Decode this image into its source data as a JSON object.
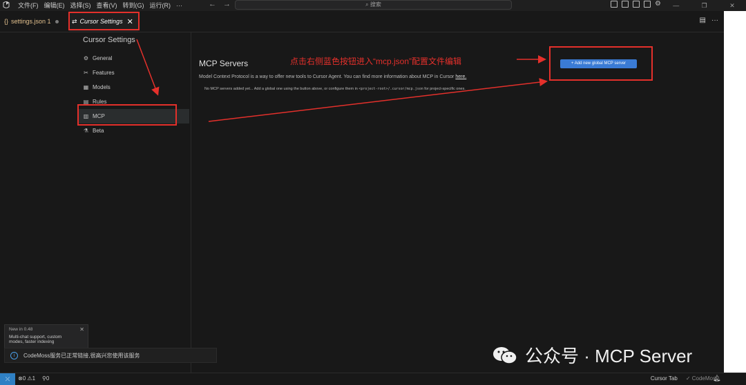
{
  "menu": [
    "文件(F)",
    "编辑(E)",
    "选择(S)",
    "查看(V)",
    "转到(G)",
    "运行(R)",
    "···"
  ],
  "nav": {
    "back": "←",
    "forward": "→"
  },
  "search": {
    "placeholder": "搜索",
    "icon": "search-icon"
  },
  "window_controls": [
    "—",
    "❐",
    "✕"
  ],
  "tabs": [
    {
      "label": "settings.json 1",
      "icon": "json-braces-icon"
    },
    {
      "label": "Cursor Settings",
      "icon": "settings-swap-icon",
      "close": "✕"
    }
  ],
  "tab_actions": [
    "▤",
    "···"
  ],
  "settings": {
    "title": "Cursor Settings",
    "nav": [
      {
        "label": "General",
        "icon": "gear-icon"
      },
      {
        "label": "Features",
        "icon": "tools-icon"
      },
      {
        "label": "Models",
        "icon": "cube-icon"
      },
      {
        "label": "Rules",
        "icon": "document-icon"
      },
      {
        "label": "MCP",
        "icon": "server-icon"
      },
      {
        "label": "Beta",
        "icon": "flask-icon"
      }
    ]
  },
  "mcp": {
    "heading": "MCP Servers",
    "description": "Model Context Protocol is a way to offer new tools to Cursor Agent. You can find more information about MCP in Cursor",
    "link": "here.",
    "note_pre": "No MCP servers added yet... Add a global one using the button above, or configure them in",
    "note_code": "<project-root>/.cursor/mcp.json",
    "note_post": "for project-specific ones.",
    "add_button": "+ Add new global MCP server"
  },
  "annotation": "点击右侧蓝色按钮进入“mcp.json”配置文件编辑",
  "popup": {
    "version": "New in 0.48",
    "line1": "Multi-chat support, custom",
    "line2": "modes, faster indexing",
    "close": "✕"
  },
  "notice": {
    "text": "CodeMoss服务已正常链接,很高兴您使用该服务",
    "icon": "info-icon"
  },
  "watermark": {
    "text": "公众号 · MCP Server"
  },
  "status": {
    "errors": "⊗0",
    "warnings": "⚠1",
    "ports": "0",
    "cursor_tab": "Cursor Tab",
    "codemoss": "✓ CodeMoss"
  },
  "colors": {
    "accent": "#3a7bd5",
    "annotation_red": "#e5302b",
    "background": "#181818"
  }
}
